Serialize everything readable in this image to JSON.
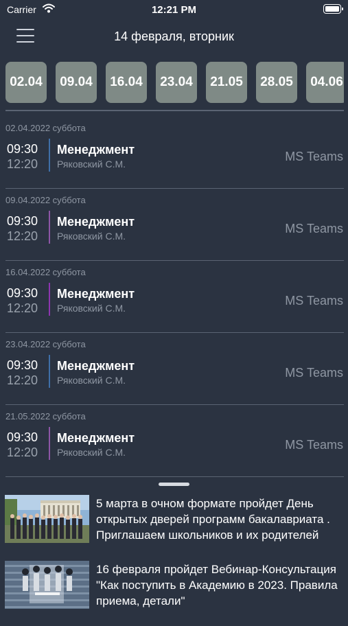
{
  "status_bar": {
    "carrier": "Carrier",
    "time": "12:21 PM"
  },
  "header": {
    "title": "14 февраля, вторник"
  },
  "date_chips": [
    "02.04",
    "09.04",
    "16.04",
    "23.04",
    "21.05",
    "28.05",
    "04.06"
  ],
  "lessons": [
    {
      "date": "02.04.2022 суббота",
      "start": "09:30",
      "end": "12:20",
      "subject": "Менеджмент",
      "teacher": "Ряковский С.М.",
      "place": "MS Teams",
      "bar_color": "#3f6fa8"
    },
    {
      "date": "09.04.2022 суббота",
      "start": "09:30",
      "end": "12:20",
      "subject": "Менеджмент",
      "teacher": "Ряковский С.М.",
      "place": "MS Teams",
      "bar_color": "#8d55a6"
    },
    {
      "date": "16.04.2022 суббота",
      "start": "09:30",
      "end": "12:20",
      "subject": "Менеджмент",
      "teacher": "Ряковский С.М.",
      "place": "MS Teams",
      "bar_color": "#8d35b0"
    },
    {
      "date": "23.04.2022 суббота",
      "start": "09:30",
      "end": "12:20",
      "subject": "Менеджмент",
      "teacher": "Ряковский С.М.",
      "place": "MS Teams",
      "bar_color": "#3f6fa8"
    },
    {
      "date": "21.05.2022 суббота",
      "start": "09:30",
      "end": "12:20",
      "subject": "Менеджмент",
      "teacher": "Ряковский С.М.",
      "place": "MS Teams",
      "bar_color": "#8d55a6"
    }
  ],
  "news": [
    {
      "text": "5 марта в очном формате пройдет День открытых дверей программ бакалавриата . Приглашаем школьников и их родителей"
    },
    {
      "text": "16 февраля пройдет Вебинар-Консультация \"Как поступить в Академию в 2023. Правила приема, детали\""
    }
  ],
  "colors": {
    "background": "#2b3341",
    "chip": "#7f8a86",
    "divider": "#5b6473",
    "muted_text": "#8f97a3"
  }
}
